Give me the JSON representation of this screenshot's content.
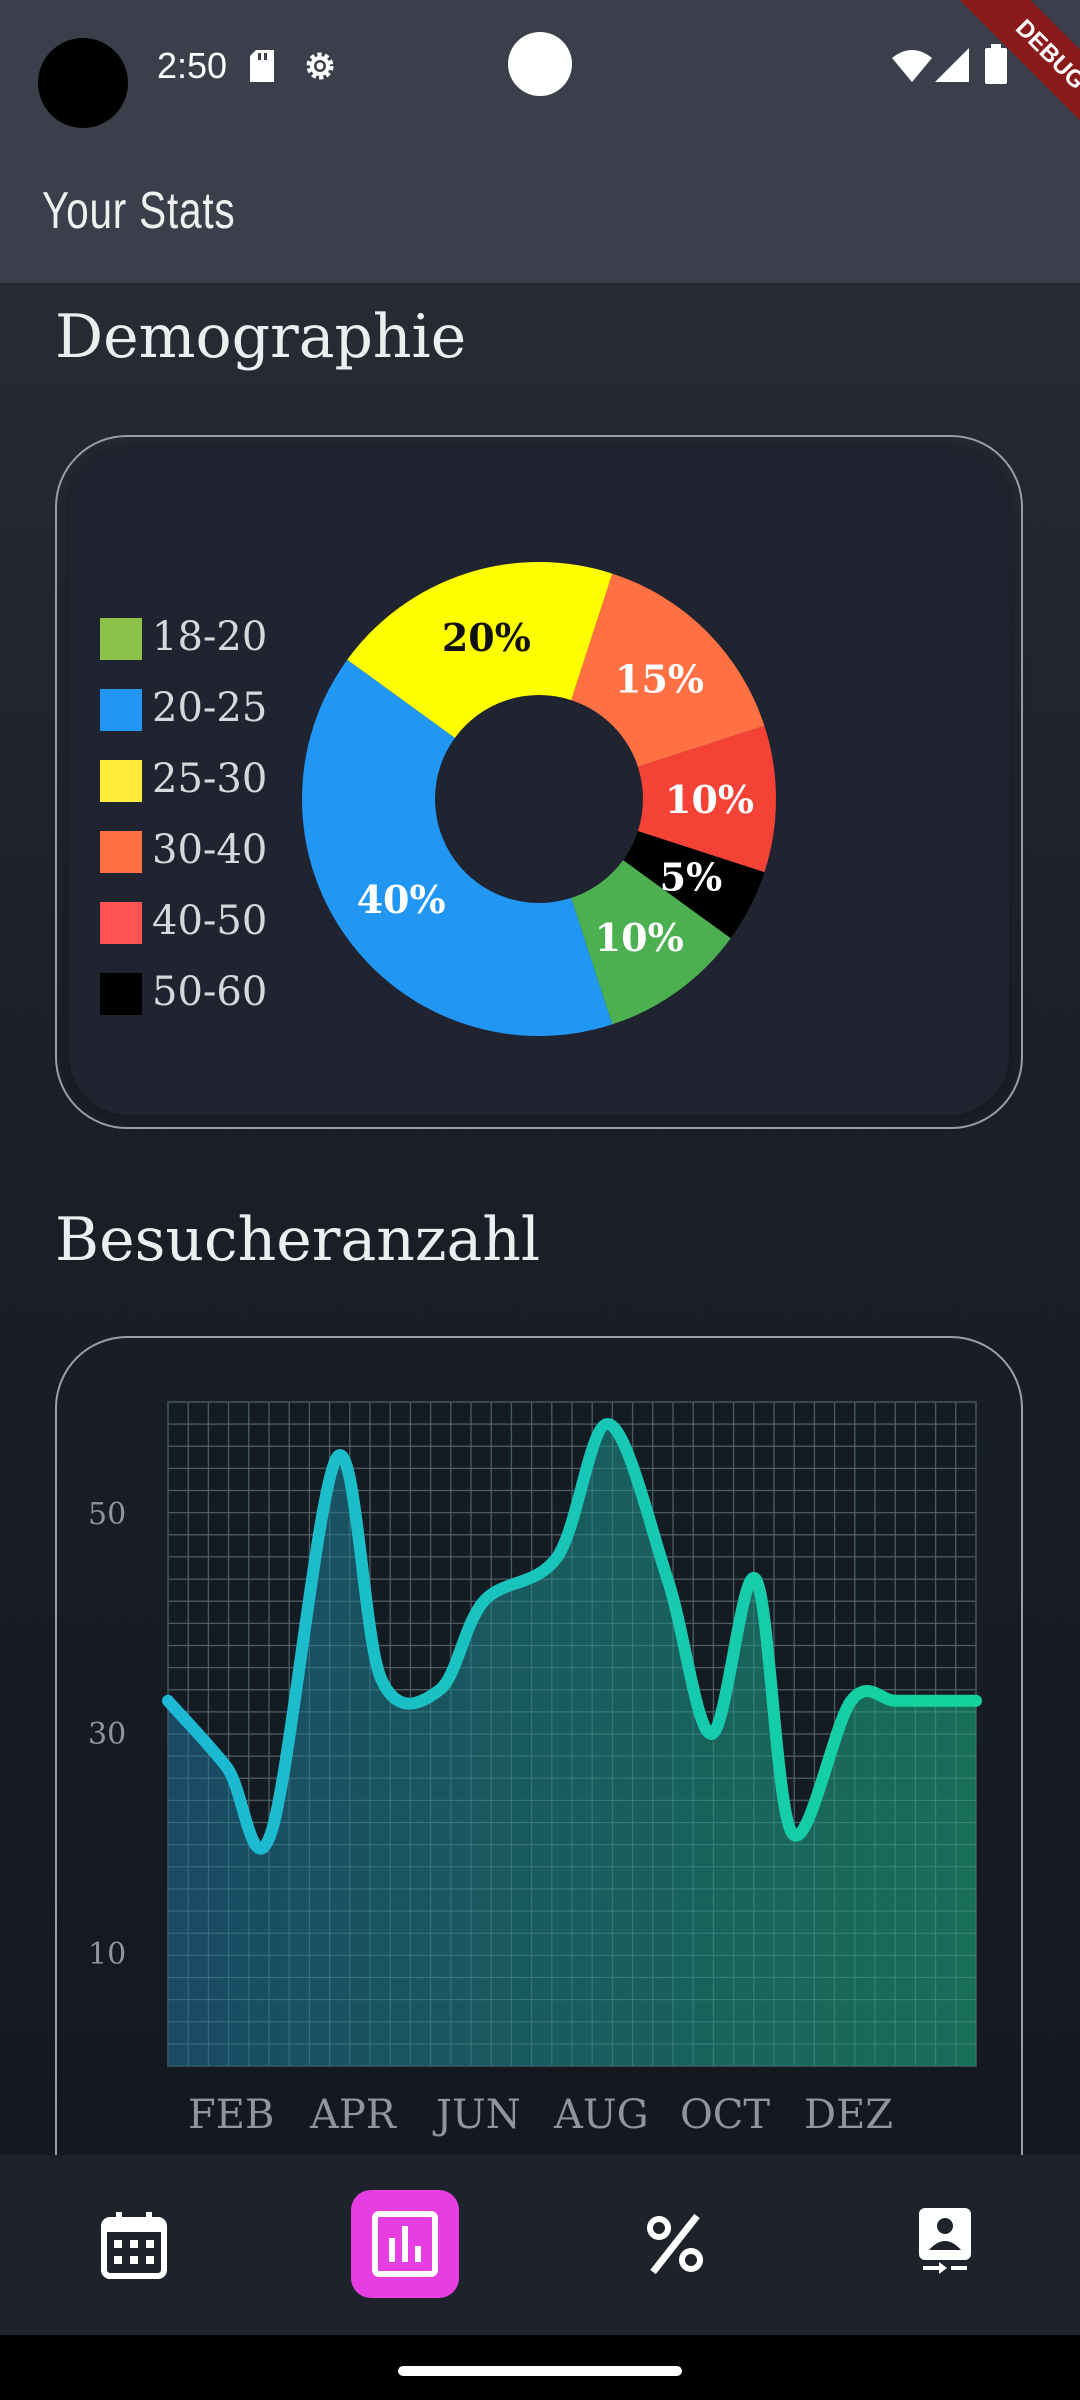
{
  "status_bar": {
    "time": "2:50"
  },
  "debug_banner": "DEBUG",
  "app_bar": {
    "title": "Your Stats"
  },
  "demographics": {
    "title": "Demographie",
    "legend": [
      {
        "label": "18-20",
        "color": "#8bc34a"
      },
      {
        "label": "20-25",
        "color": "#2196f3"
      },
      {
        "label": "25-30",
        "color": "#ffeb3b"
      },
      {
        "label": "30-40",
        "color": "#ff7043"
      },
      {
        "label": "40-50",
        "color": "#ff5252"
      },
      {
        "label": "50-60",
        "color": "#000000"
      }
    ]
  },
  "visitors": {
    "title": "Besucheranzahl"
  },
  "chart_data": [
    {
      "type": "pie",
      "donut": true,
      "slices": [
        {
          "label": "15%",
          "value": 15,
          "color": "#ff7043"
        },
        {
          "label": "10%",
          "value": 10,
          "color": "#f44336"
        },
        {
          "label": "5%",
          "value": 5,
          "color": "#000000"
        },
        {
          "label": "10%",
          "value": 10,
          "color": "#4caf50"
        },
        {
          "label": "40%",
          "value": 40,
          "color": "#2196f3"
        },
        {
          "label": "20%",
          "value": 20,
          "color": "#ffff00"
        }
      ]
    },
    {
      "type": "area",
      "x": [
        0,
        0.8,
        1.4,
        2.3,
        2.9,
        3.7,
        4.3,
        5.3,
        6.0,
        6.8,
        7.4,
        8.0,
        8.5,
        9.3,
        9.9,
        10.5,
        11.0
      ],
      "y": [
        33,
        27,
        21,
        55,
        35,
        34,
        42,
        46,
        58,
        44,
        30,
        44,
        21,
        33,
        33,
        33,
        33
      ],
      "x_tick_labels": [
        "FEB",
        "APR",
        "JUN",
        "AUG",
        "OCT",
        "DEZ"
      ],
      "y_ticks": [
        10,
        30,
        50
      ],
      "ylim": [
        0,
        60
      ],
      "grid": true,
      "line_colors": [
        "#1db8d6",
        "#13d49a"
      ]
    }
  ],
  "nav": [
    {
      "icon": "calendar-icon",
      "active": false
    },
    {
      "icon": "chart-icon",
      "active": true,
      "active_color": "#e63ee0"
    },
    {
      "icon": "percent-icon",
      "active": false
    },
    {
      "icon": "contact-transfer-icon",
      "active": false
    }
  ]
}
